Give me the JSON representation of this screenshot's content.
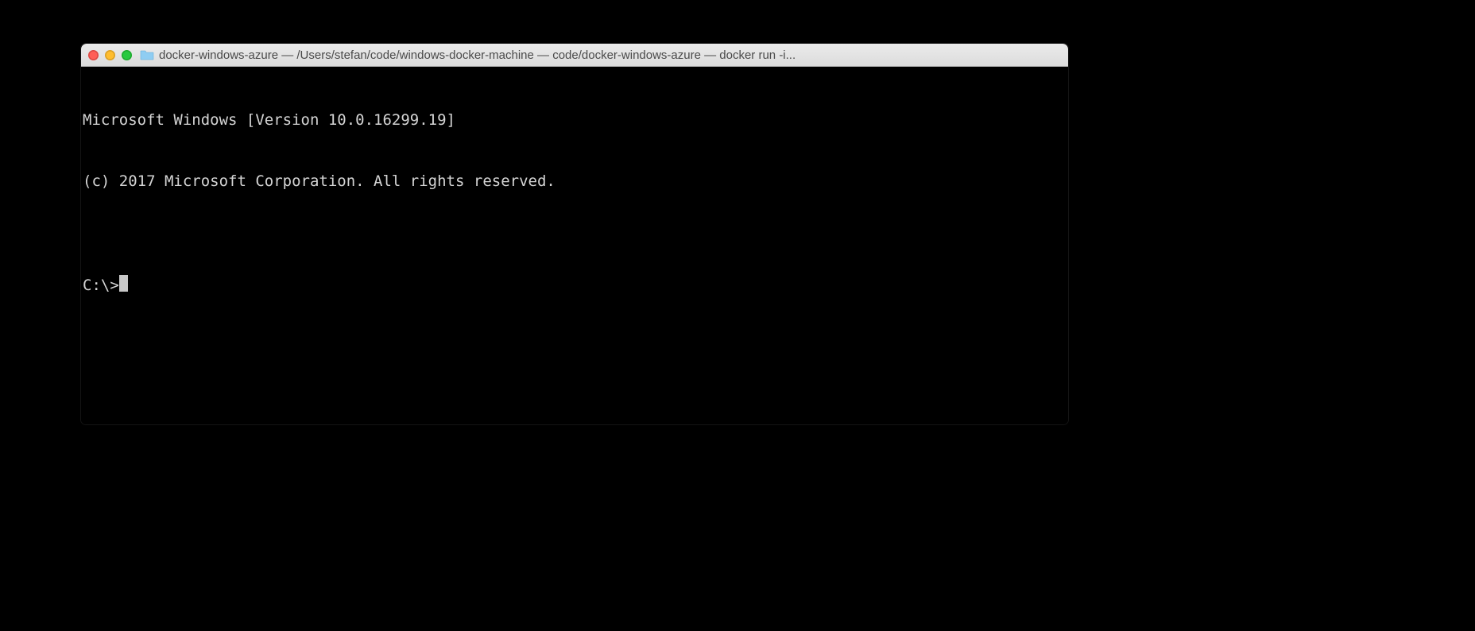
{
  "window": {
    "title": "docker-windows-azure — /Users/stefan/code/windows-docker-machine — code/docker-windows-azure — docker run -i..."
  },
  "terminal": {
    "line1": "Microsoft Windows [Version 10.0.16299.19]",
    "line2": "(c) 2017 Microsoft Corporation. All rights reserved.",
    "blank": "",
    "prompt": "C:\\>"
  }
}
